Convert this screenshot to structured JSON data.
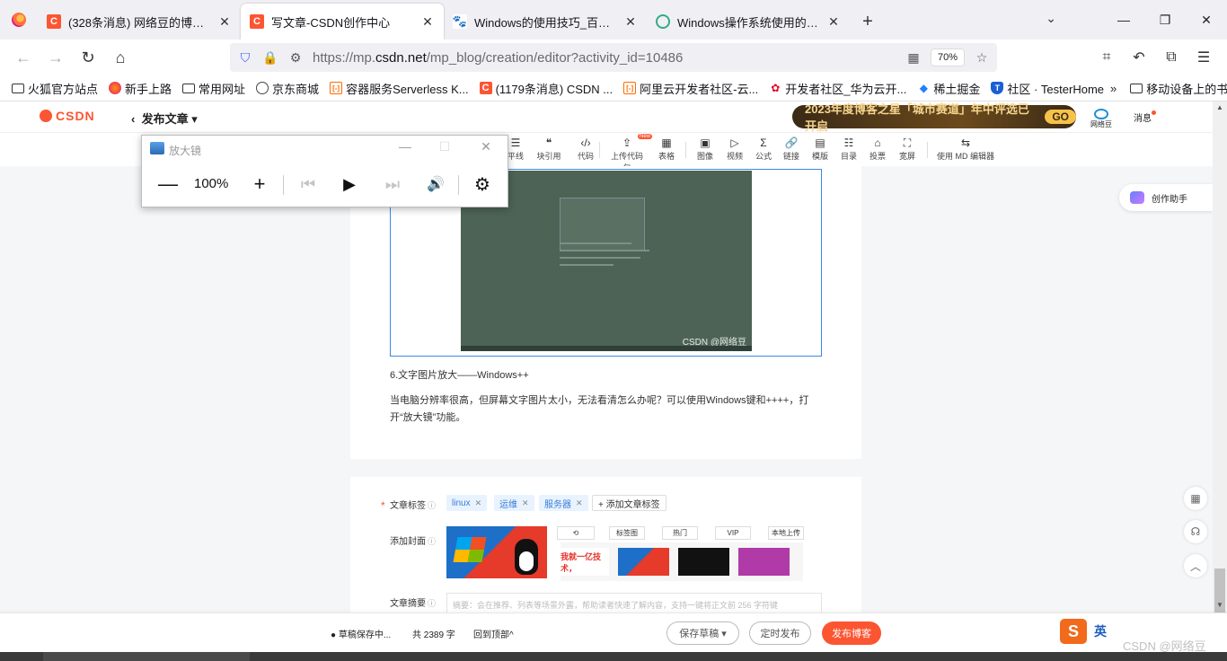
{
  "browser": {
    "tabs": [
      {
        "title": "(328条消息) 网络豆的博客_CSDN",
        "icon": "csdn-icon",
        "active": false
      },
      {
        "title": "写文章-CSDN创作中心",
        "icon": "csdn-icon",
        "active": true
      },
      {
        "title": "Windows的使用技巧_百度搜索",
        "icon": "baidu-icon",
        "active": false
      },
      {
        "title": "Windows操作系统使用的十个小技巧",
        "icon": "web-icon",
        "active": false
      }
    ],
    "new_tab": "+",
    "address": {
      "prefix": "https://mp.",
      "domain": "csdn.net",
      "path": "/mp_blog/creation/editor?activity_id=10486"
    },
    "zoom": "70%",
    "bookmarks": [
      "火狐官方站点",
      "新手上路",
      "常用网址",
      "京东商城",
      "容器服务Serverless K...",
      "(1179条消息) CSDN ...",
      "阿里云开发者社区-云...",
      "开发者社区_华为云开...",
      "稀土掘金",
      "社区 · TesterHome"
    ],
    "bookmarks_more": "»",
    "mobile_bookmarks": "移动设备上的书签"
  },
  "csdn": {
    "logo": "CSDN",
    "publish_menu": "发布文章",
    "banner": "2023年度博客之星「城市赛道」年中评选已开启",
    "banner_go": "GO",
    "avatar_label": "网络豆",
    "messages": "消息",
    "toolbar": [
      {
        "icon": "hr-icon",
        "label": "平线"
      },
      {
        "icon": "quote-icon",
        "label": "块引用"
      },
      {
        "icon": "code-icon",
        "label": "代码"
      },
      {
        "icon": "upload-code-icon",
        "label": "上传代码包",
        "badge": "New"
      },
      {
        "icon": "table-icon",
        "label": "表格"
      },
      {
        "icon": "image-icon",
        "label": "图像"
      },
      {
        "icon": "video-icon",
        "label": "视频"
      },
      {
        "icon": "formula-icon",
        "label": "公式"
      },
      {
        "icon": "link-icon",
        "label": "链接"
      },
      {
        "icon": "template-icon",
        "label": "模版"
      },
      {
        "icon": "toc-icon",
        "label": "目录"
      },
      {
        "icon": "vote-icon",
        "label": "投票"
      },
      {
        "icon": "widescreen-icon",
        "label": "宽屏"
      },
      {
        "icon": "md-switch-icon",
        "label": "使用 MD 编辑器"
      }
    ],
    "image_watermark": "CSDN @网络豆",
    "para_heading": "6.文字图片放大——Windows++",
    "para_body": "当电脑分辨率很高，但屏幕文字图片太小，无法看清怎么办呢？可以使用Windows键和++++，打开“放大镜”功能。",
    "assistant": "创作助手",
    "meta": {
      "tags_label": "文章标签",
      "tags": [
        "linux",
        "运维",
        "服务器"
      ],
      "add_tag": "+ 添加文章标签",
      "cover_label": "添加封面",
      "cover_options": [
        "⟲",
        "标签图",
        "热门",
        "VIP",
        "本地上传"
      ],
      "thumb_text": "我就一亿技术，",
      "summary_label": "文章摘要",
      "summary_placeholder": "摘要：会在推荐、列表等场景外露，帮助读者快速了解内容，支持一键将正文前 256 字符键"
    },
    "bottom": {
      "autosave": "草稿保存中...",
      "word_count": "共 2389 字",
      "back_top": "回到顶部^",
      "save_draft": "保存草稿 ▾",
      "schedule": "定时发布",
      "publish": "发布博客"
    }
  },
  "ime": {
    "logo": "S",
    "lang": "英",
    "watermark": "CSDN @网络豆"
  },
  "magnifier": {
    "title": "放大镜",
    "zoom": "100%",
    "minus": "—",
    "plus": "+"
  },
  "colors": {
    "csdn_red": "#fc5531",
    "link_blue": "#3b7cd6"
  }
}
